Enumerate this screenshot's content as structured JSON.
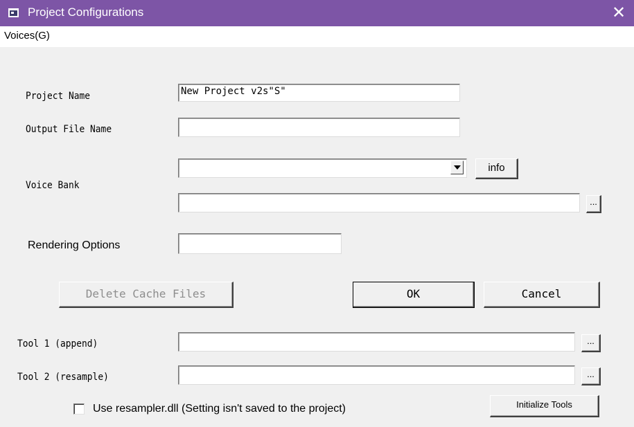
{
  "window": {
    "title": "Project Configurations",
    "close_glyph": "✕",
    "titlebar_color": "#7d55a6"
  },
  "menu": {
    "items": [
      "Voices(G)"
    ]
  },
  "form": {
    "project_name_label": "Project Name",
    "project_name_value": "New Project v2s\"S\"",
    "output_file_label": "Output File Name",
    "output_file_value": "",
    "voice_bank_label": "Voice Bank",
    "voice_bank_selected": "",
    "voice_bank_info_button": "info",
    "voice_bank_path_value": "",
    "browse_label": "...",
    "rendering_options_label": "Rendering Options",
    "rendering_options_value": ""
  },
  "buttons": {
    "delete_cache": "Delete Cache Files",
    "ok": "OK",
    "cancel": "Cancel"
  },
  "tools": {
    "tool1_label": "Tool 1 (append)",
    "tool1_value": "",
    "tool2_label": "Tool 2 (resample)",
    "tool2_value": "",
    "use_resampler_label": "Use resampler.dll (Setting isn't saved to the project)",
    "use_resampler_checked": false,
    "initialize_button": "Initialize Tools"
  },
  "icons": {
    "app": "app-window-icon",
    "close": "close-icon",
    "dropdown": "chevron-down-icon"
  }
}
